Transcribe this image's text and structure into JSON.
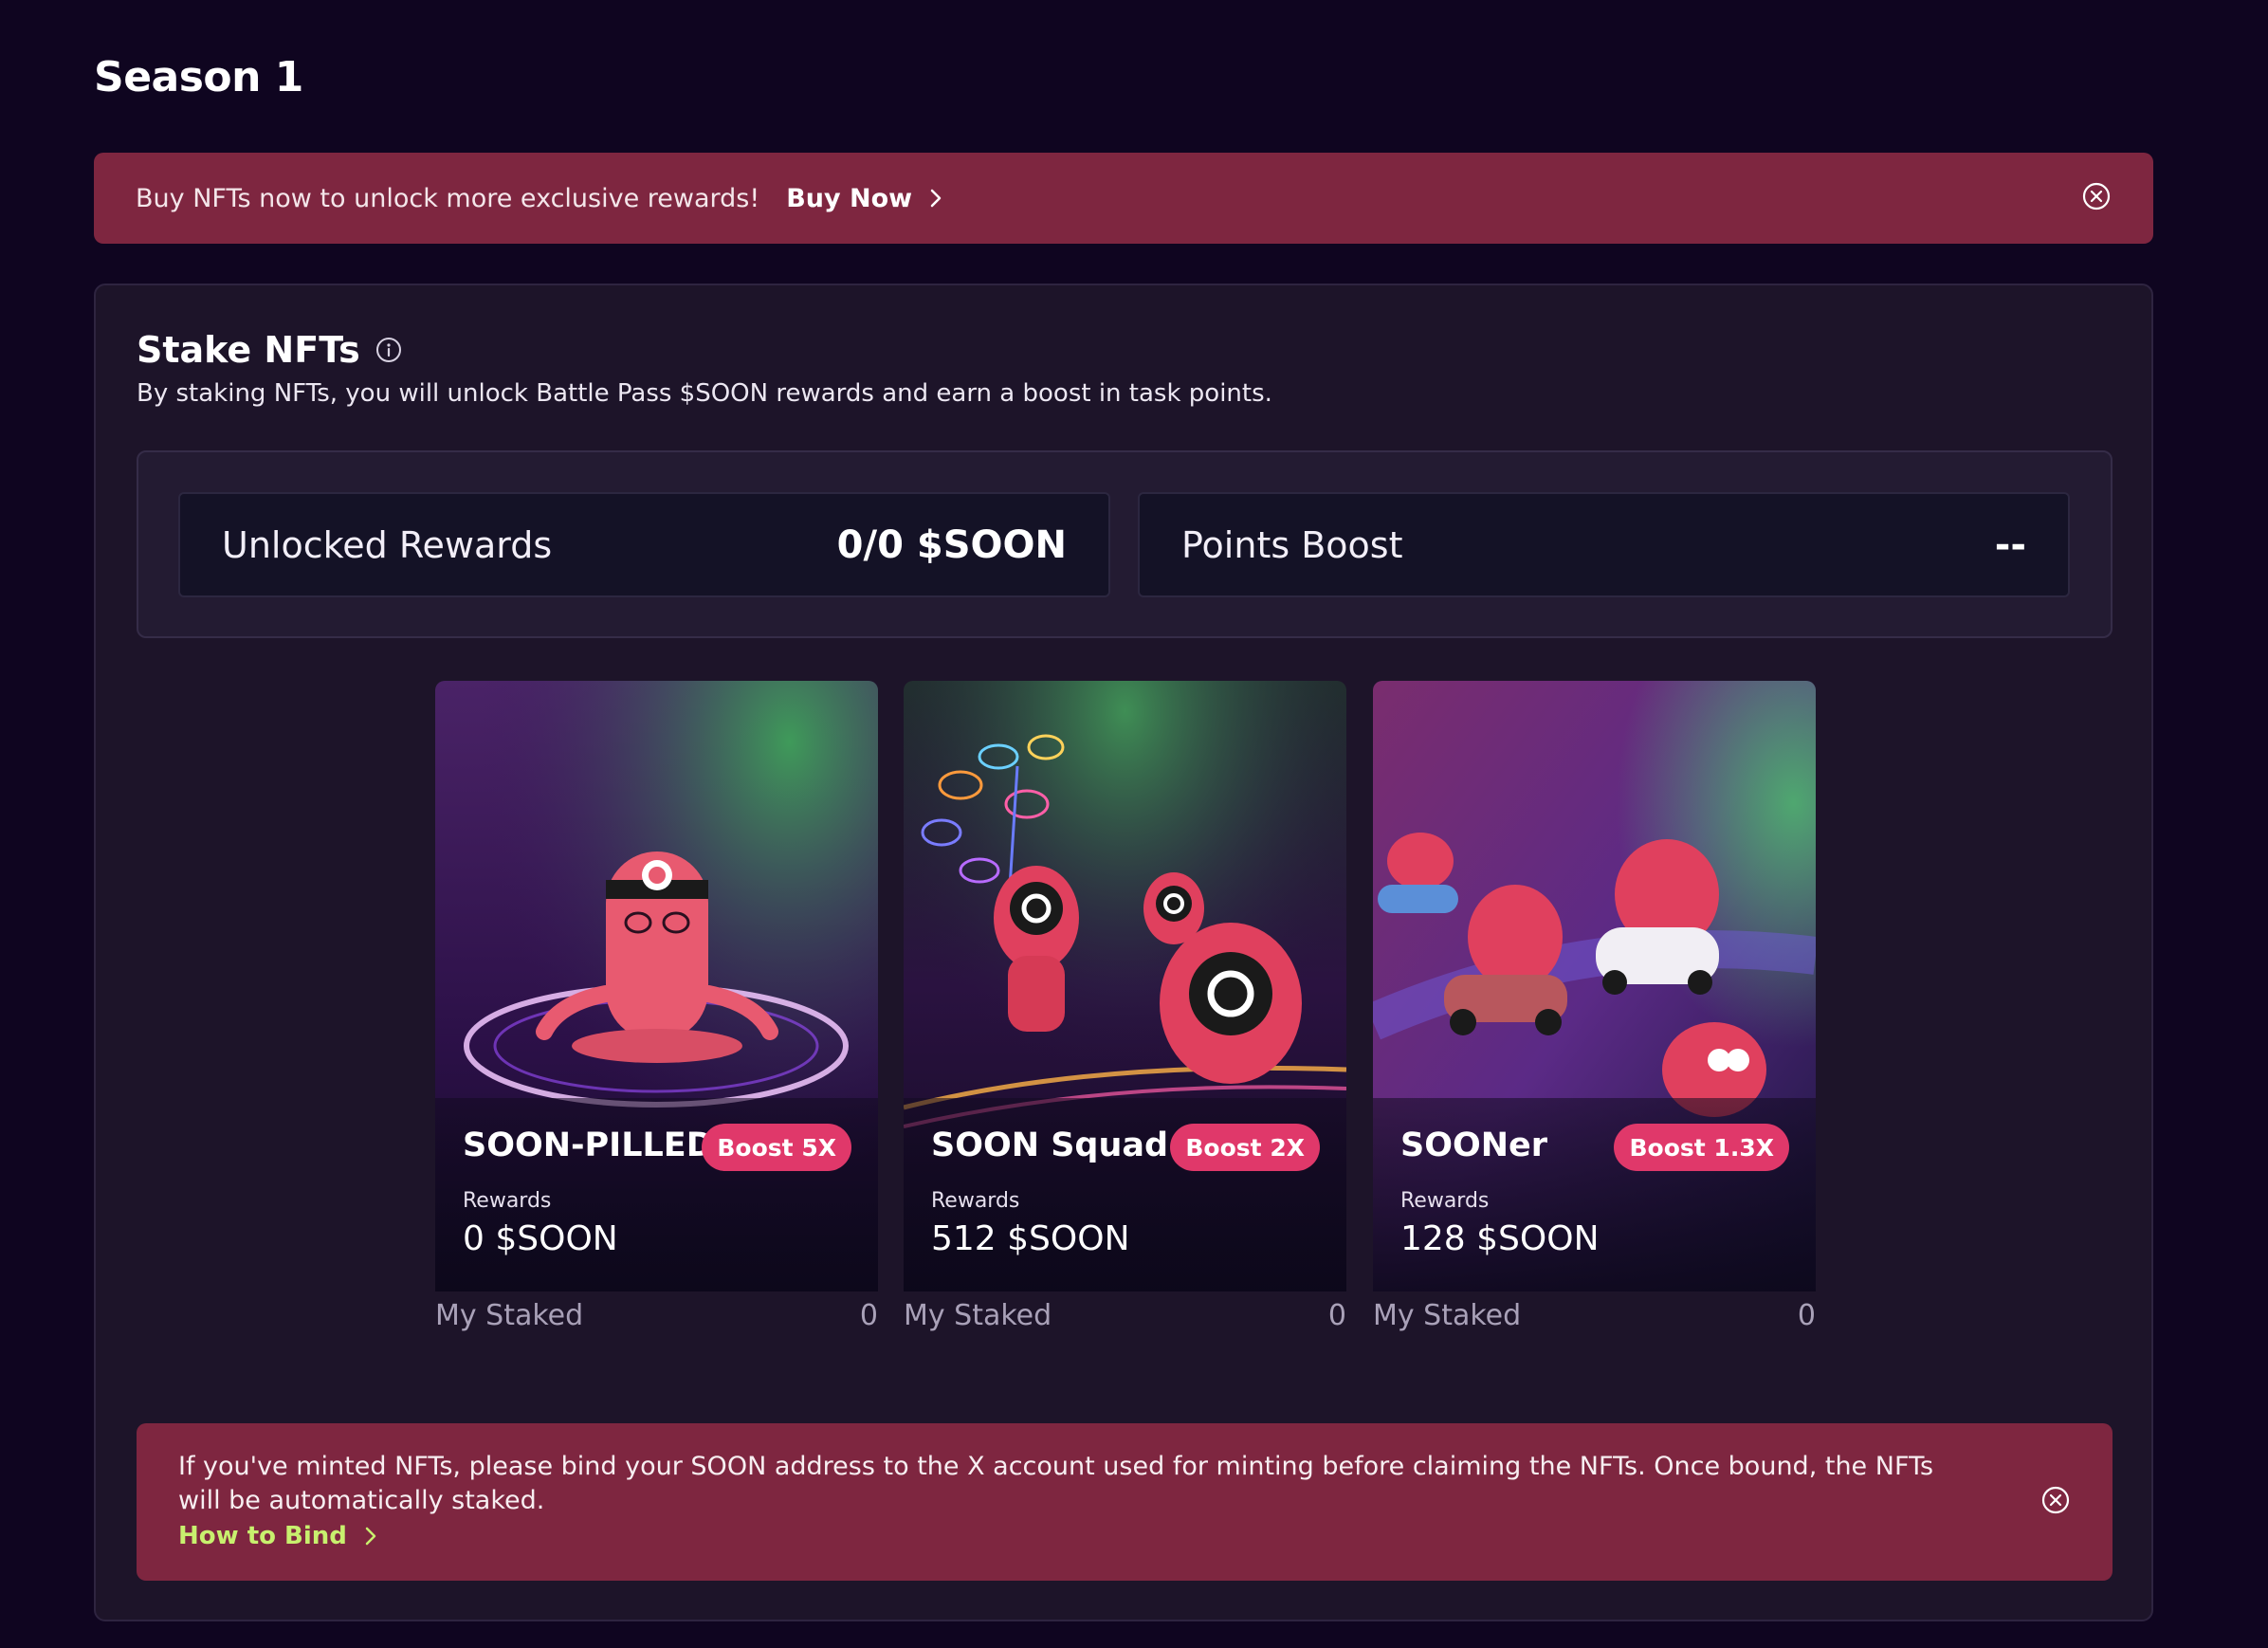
{
  "page": {
    "title": "Season 1"
  },
  "top_banner": {
    "message": "Buy NFTs now to unlock more exclusive rewards!",
    "cta_label": "Buy Now"
  },
  "stake": {
    "title": "Stake NFTs",
    "description": "By staking NFTs, you will unlock Battle Pass $SOON rewards and earn a boost in task points.",
    "stats": [
      {
        "label": "Unlocked Rewards",
        "value": "0/0 $SOON"
      },
      {
        "label": "Points Boost",
        "value": "--"
      }
    ],
    "cards": [
      {
        "name": "SOON-PILLED",
        "boost": "Boost 5X",
        "rewards_label": "Rewards",
        "rewards_value": "0 $SOON",
        "staked_label": "My Staked",
        "staked_value": "0"
      },
      {
        "name": "SOON Squad",
        "boost": "Boost 2X",
        "rewards_label": "Rewards",
        "rewards_value": "512 $SOON",
        "staked_label": "My Staked",
        "staked_value": "0"
      },
      {
        "name": "SOONer",
        "boost": "Boost 1.3X",
        "rewards_label": "Rewards",
        "rewards_value": "128 $SOON",
        "staked_label": "My Staked",
        "staked_value": "0"
      }
    ]
  },
  "bottom_banner": {
    "message": "If you've minted NFTs, please bind your SOON address to the X account used for minting before claiming the NFTs. Once bound, the NFTs will be automatically staked.",
    "link_label": "How to Bind"
  },
  "colors": {
    "background": "#0f0520",
    "banner": "#7e2640",
    "boost_badge": "#e0386a",
    "link_green": "#c8f06e"
  },
  "icons": [
    "chevron-right-icon",
    "close-circle-icon",
    "info-icon"
  ]
}
